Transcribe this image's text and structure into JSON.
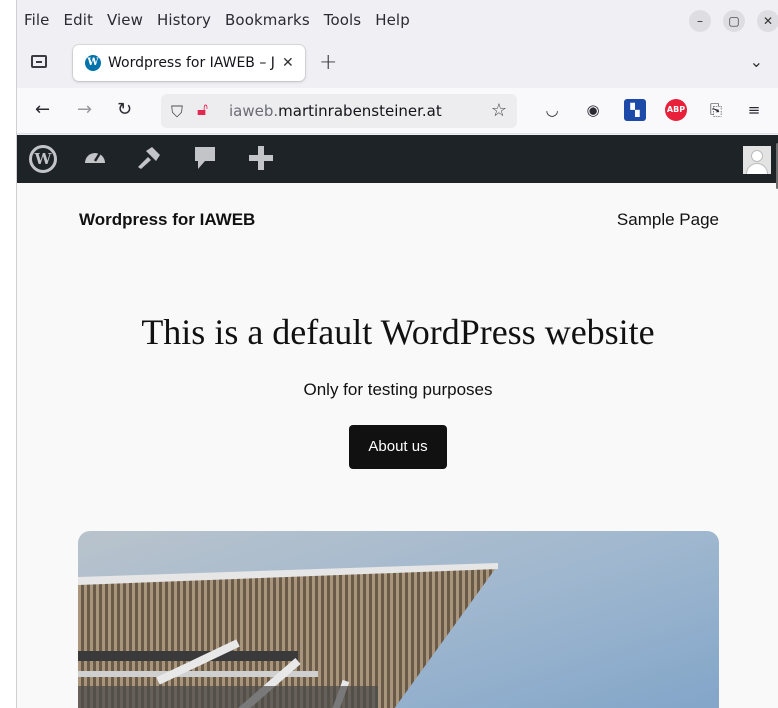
{
  "menubar": {
    "items": [
      "File",
      "Edit",
      "View",
      "History",
      "Bookmarks",
      "Tools",
      "Help"
    ],
    "window_controls": [
      "minimize",
      "maximize",
      "close"
    ]
  },
  "tab": {
    "title": "Wordpress for IAWEB – J",
    "favicon": "W"
  },
  "toolbar": {
    "back_icon": "←",
    "forward_icon": "→",
    "reload_icon": "C",
    "url_dim": "iaweb.",
    "url_domain": "martinrabensteiner.at",
    "extensions": [
      "pocket-icon",
      "account-icon",
      "extension-blue-icon",
      "adblock-plus-icon",
      "extensions-icon",
      "menu-icon"
    ],
    "abp_label": "ABP"
  },
  "adminbar": {
    "icons": [
      "wordpress-logo-icon",
      "dashboard-icon",
      "customize-icon",
      "comments-icon",
      "new-content-icon",
      "avatar"
    ]
  },
  "site": {
    "title": "Wordpress for IAWEB",
    "nav_link": "Sample Page",
    "heading": "This is a default WordPress website",
    "subheading": "Only for testing purposes",
    "button_label": "About us"
  },
  "colors": {
    "adminbar_bg": "#1d2327",
    "page_bg": "#f9f9f9",
    "button_bg": "#111111",
    "wp_blue": "#0073aa",
    "abp_red": "#e8203a"
  }
}
